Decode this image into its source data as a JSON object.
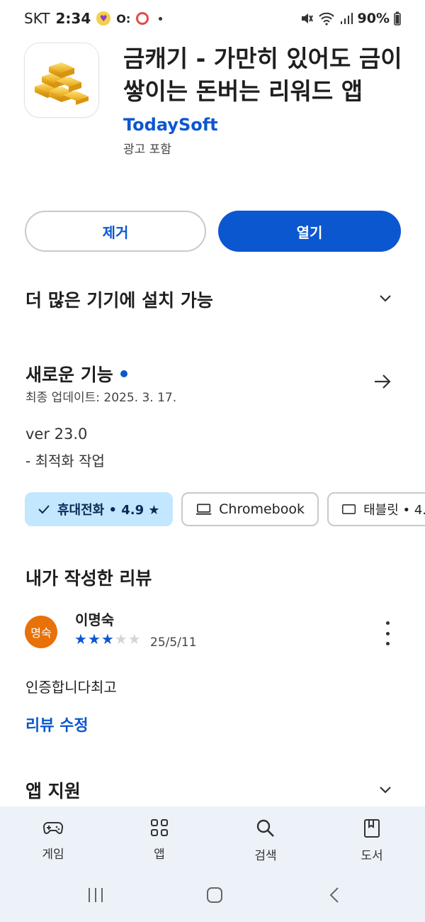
{
  "status_bar": {
    "carrier": "SKT",
    "time": "2:34",
    "battery": "90%"
  },
  "app": {
    "title": "금캐기 - 가만히 있어도 금이 쌓이는 돈버는 리워드 앱",
    "developer": "TodaySoft",
    "ads_note": "광고 포함",
    "icon": "gold-bars-icon"
  },
  "actions": {
    "remove_label": "제거",
    "open_label": "열기"
  },
  "more_devices": {
    "label": "더 많은 기기에 설치 가능"
  },
  "whats_new": {
    "title": "새로운 기능",
    "updated": "최종 업데이트: 2025. 3. 17.",
    "version": "ver 23.0",
    "note": "- 최적화 작업"
  },
  "device_chips": [
    {
      "label": "휴대전화 • 4.9 ★",
      "selected": true
    },
    {
      "label": "Chromebook",
      "selected": false
    },
    {
      "label": "태블릿 • 4.",
      "selected": false
    }
  ],
  "my_review": {
    "section_title": "내가 작성한 리뷰",
    "avatar_text": "명숙",
    "reviewer": "이명숙",
    "rating": 3,
    "max_rating": 5,
    "date": "25/5/11",
    "text": "인증합니다최고",
    "edit_label": "리뷰 수정"
  },
  "app_support": {
    "label": "앱 지원"
  },
  "bottom_nav": {
    "items": [
      {
        "label": "게임",
        "icon": "gamepad-icon"
      },
      {
        "label": "앱",
        "icon": "apps-grid-icon"
      },
      {
        "label": "검색",
        "icon": "search-icon"
      },
      {
        "label": "도서",
        "icon": "book-icon"
      }
    ]
  },
  "colors": {
    "accent": "#0b57d0",
    "chip_selected": "#c2e7ff",
    "nav_background": "#edf2f9",
    "avatar": "#e8710a"
  }
}
